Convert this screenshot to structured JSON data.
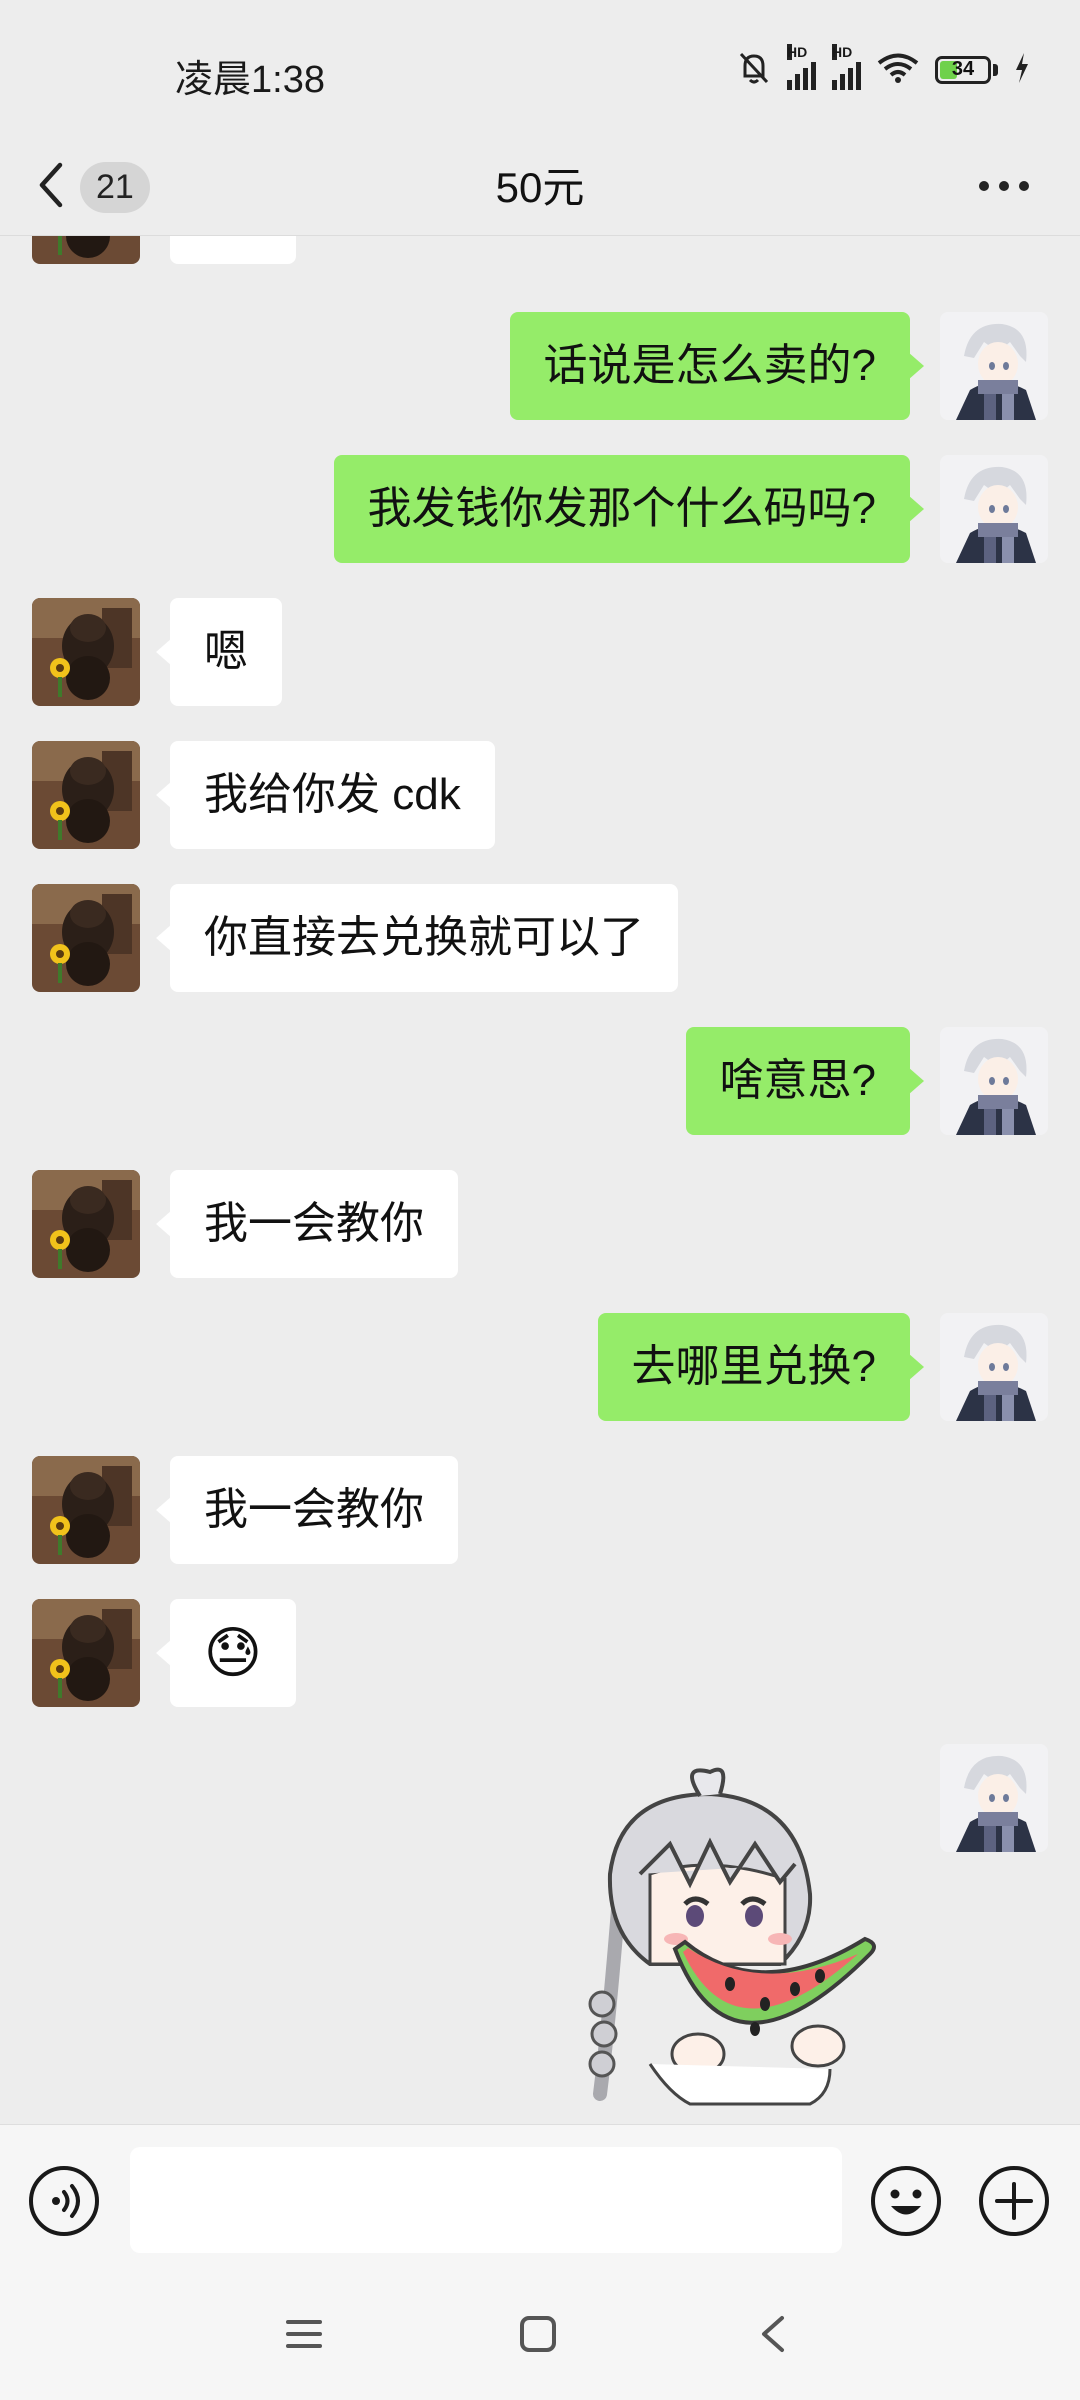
{
  "status": {
    "time": "凌晨1:38",
    "battery": "34",
    "hd_label": "HD",
    "icons": [
      "mute-bell-icon",
      "signal-icon",
      "signal-icon",
      "wifi-icon",
      "battery-icon",
      "charging-icon"
    ]
  },
  "header": {
    "unread_count": "21",
    "title": "50元",
    "back_icon": "chevron-left-icon",
    "more_icon": "more-dots-icon"
  },
  "messages": [
    {
      "side": "left",
      "type": "emoji",
      "emoji": "🙏"
    },
    {
      "side": "right",
      "type": "text",
      "text": "话说是怎么卖的?"
    },
    {
      "side": "right",
      "type": "text",
      "text": "我发钱你发那个什么码吗?"
    },
    {
      "side": "left",
      "type": "text",
      "text": "嗯"
    },
    {
      "side": "left",
      "type": "text",
      "text": "我给你发 cdk"
    },
    {
      "side": "left",
      "type": "text",
      "text": "你直接去兑换就可以了"
    },
    {
      "side": "right",
      "type": "text",
      "text": "啥意思?"
    },
    {
      "side": "left",
      "type": "text",
      "text": "我一会教你"
    },
    {
      "side": "right",
      "type": "text",
      "text": "去哪里兑换?"
    },
    {
      "side": "left",
      "type": "text",
      "text": "我一会教你"
    },
    {
      "side": "left",
      "type": "emoji",
      "emoji": "😓"
    },
    {
      "side": "right",
      "type": "sticker",
      "sticker": "girl-eating-watermelon-sticker"
    }
  ],
  "input": {
    "placeholder": "",
    "voice_icon": "voice-icon",
    "emoji_icon": "emoji-icon",
    "plus_icon": "plus-icon"
  },
  "system_nav": [
    "menu-icon",
    "home-square-icon",
    "back-triangle-icon"
  ],
  "colors": {
    "background": "#ededed",
    "sent_bubble": "#95ec69",
    "received_bubble": "#ffffff"
  }
}
